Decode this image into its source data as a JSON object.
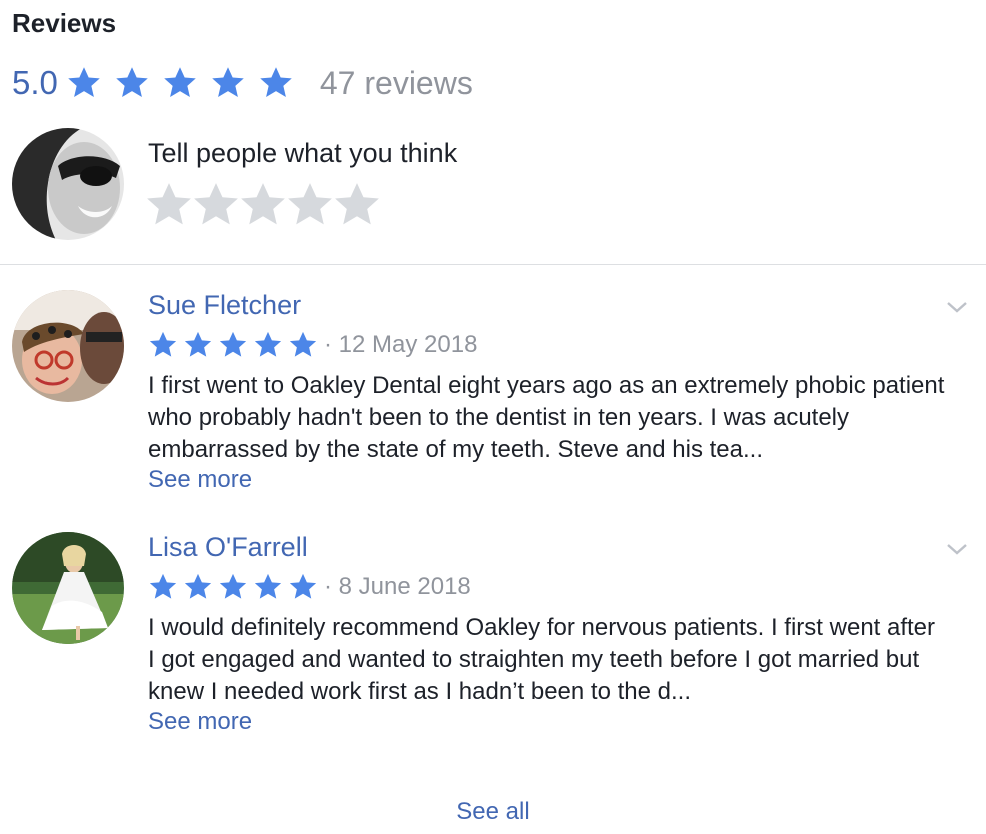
{
  "section": {
    "title": "Reviews"
  },
  "summary": {
    "score": "5.0",
    "stars": 5,
    "count_label": "47 reviews"
  },
  "compose": {
    "prompt": "Tell people what you think",
    "rating": 0
  },
  "reviews": [
    {
      "name": "Sue Fletcher",
      "stars": 5,
      "date": "· 12 May 2018",
      "text": "I first went to Oakley Dental eight years ago as an extremely phobic patient who probably hadn't been to the dentist in ten years. I was acutely embarrassed by the state of my teeth. Steve and his tea...",
      "see_more": "See more"
    },
    {
      "name": "Lisa O'Farrell",
      "stars": 5,
      "date": "· 8 June 2018",
      "text": "I would definitely recommend Oakley for nervous patients. I first went after I got engaged and wanted to straighten my teeth before I got married but knew I needed work first as I hadn’t been to the d...",
      "see_more": "See more"
    }
  ],
  "footer": {
    "see_all": "See all"
  },
  "colors": {
    "star_filled": "#4c86e8",
    "star_empty": "#d6d9dd",
    "link": "#4267b2",
    "muted": "#90949c"
  },
  "icons": {
    "star": "star-icon",
    "chevron": "chevron-down-icon"
  }
}
